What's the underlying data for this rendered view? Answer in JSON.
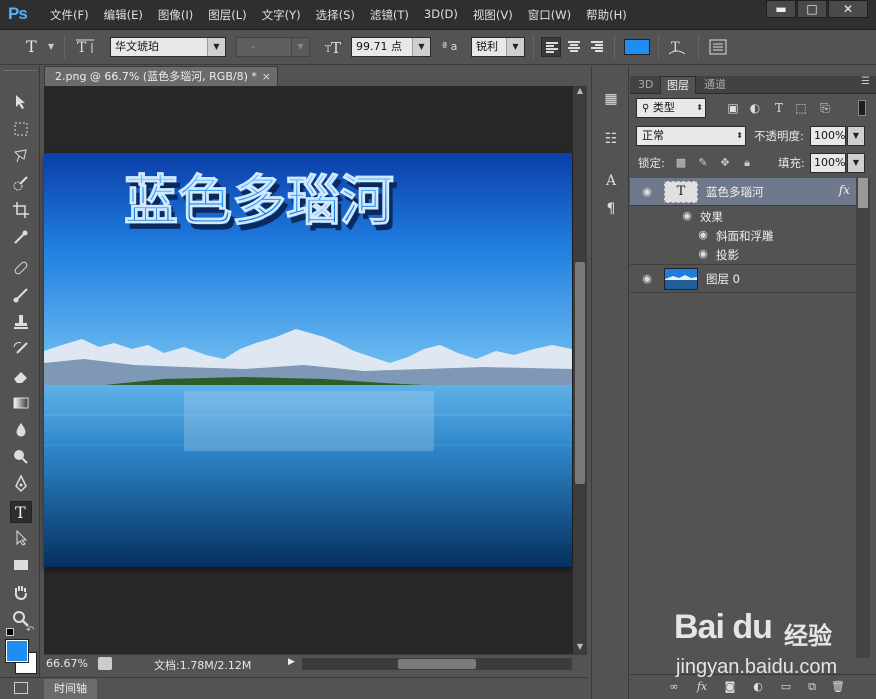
{
  "app": {
    "logo": "Ps",
    "menu": [
      "文件(F)",
      "编辑(E)",
      "图像(I)",
      "图层(L)",
      "文字(Y)",
      "选择(S)",
      "滤镜(T)",
      "3D(D)",
      "视图(V)",
      "窗口(W)",
      "帮助(H)"
    ],
    "window_controls": {
      "minimize": "▬",
      "maximize": "□",
      "close": "✕"
    }
  },
  "options": {
    "tool_glyph": "T",
    "font_family": "华文琥珀",
    "font_style": "-",
    "font_size": "99.71 点",
    "aa_label": "ª a",
    "antialias": "锐利",
    "color": "#1f8ef2"
  },
  "document": {
    "tab_title": "2.png @ 66.7% (蓝色多瑙河, RGB/8) *",
    "tab_close": "×",
    "text_layer_content": "蓝色多瑙河",
    "zoom": "66.67%",
    "doc_info": "文档:1.78M/2.12M"
  },
  "timeline": {
    "label": "时间轴"
  },
  "layers_panel": {
    "tabs": [
      "3D",
      "图层",
      "通道"
    ],
    "active_tab": "图层",
    "filter_kind": "类型",
    "blend_mode": "正常",
    "opacity_label": "不透明度:",
    "opacity_value": "100%",
    "lock_label": "锁定:",
    "fill_label": "填充:",
    "fill_value": "100%",
    "layers": [
      {
        "name": "蓝色多瑙河",
        "type": "text",
        "selected": true,
        "fx": "fx"
      },
      {
        "name": "图层 0",
        "type": "image",
        "selected": false
      }
    ],
    "effects_label": "效果",
    "effects": [
      "斜面和浮雕",
      "投影"
    ]
  },
  "watermark": {
    "brand_logo": "Bai du",
    "brand_text": "经验",
    "url": "jingyan.baidu.com"
  }
}
